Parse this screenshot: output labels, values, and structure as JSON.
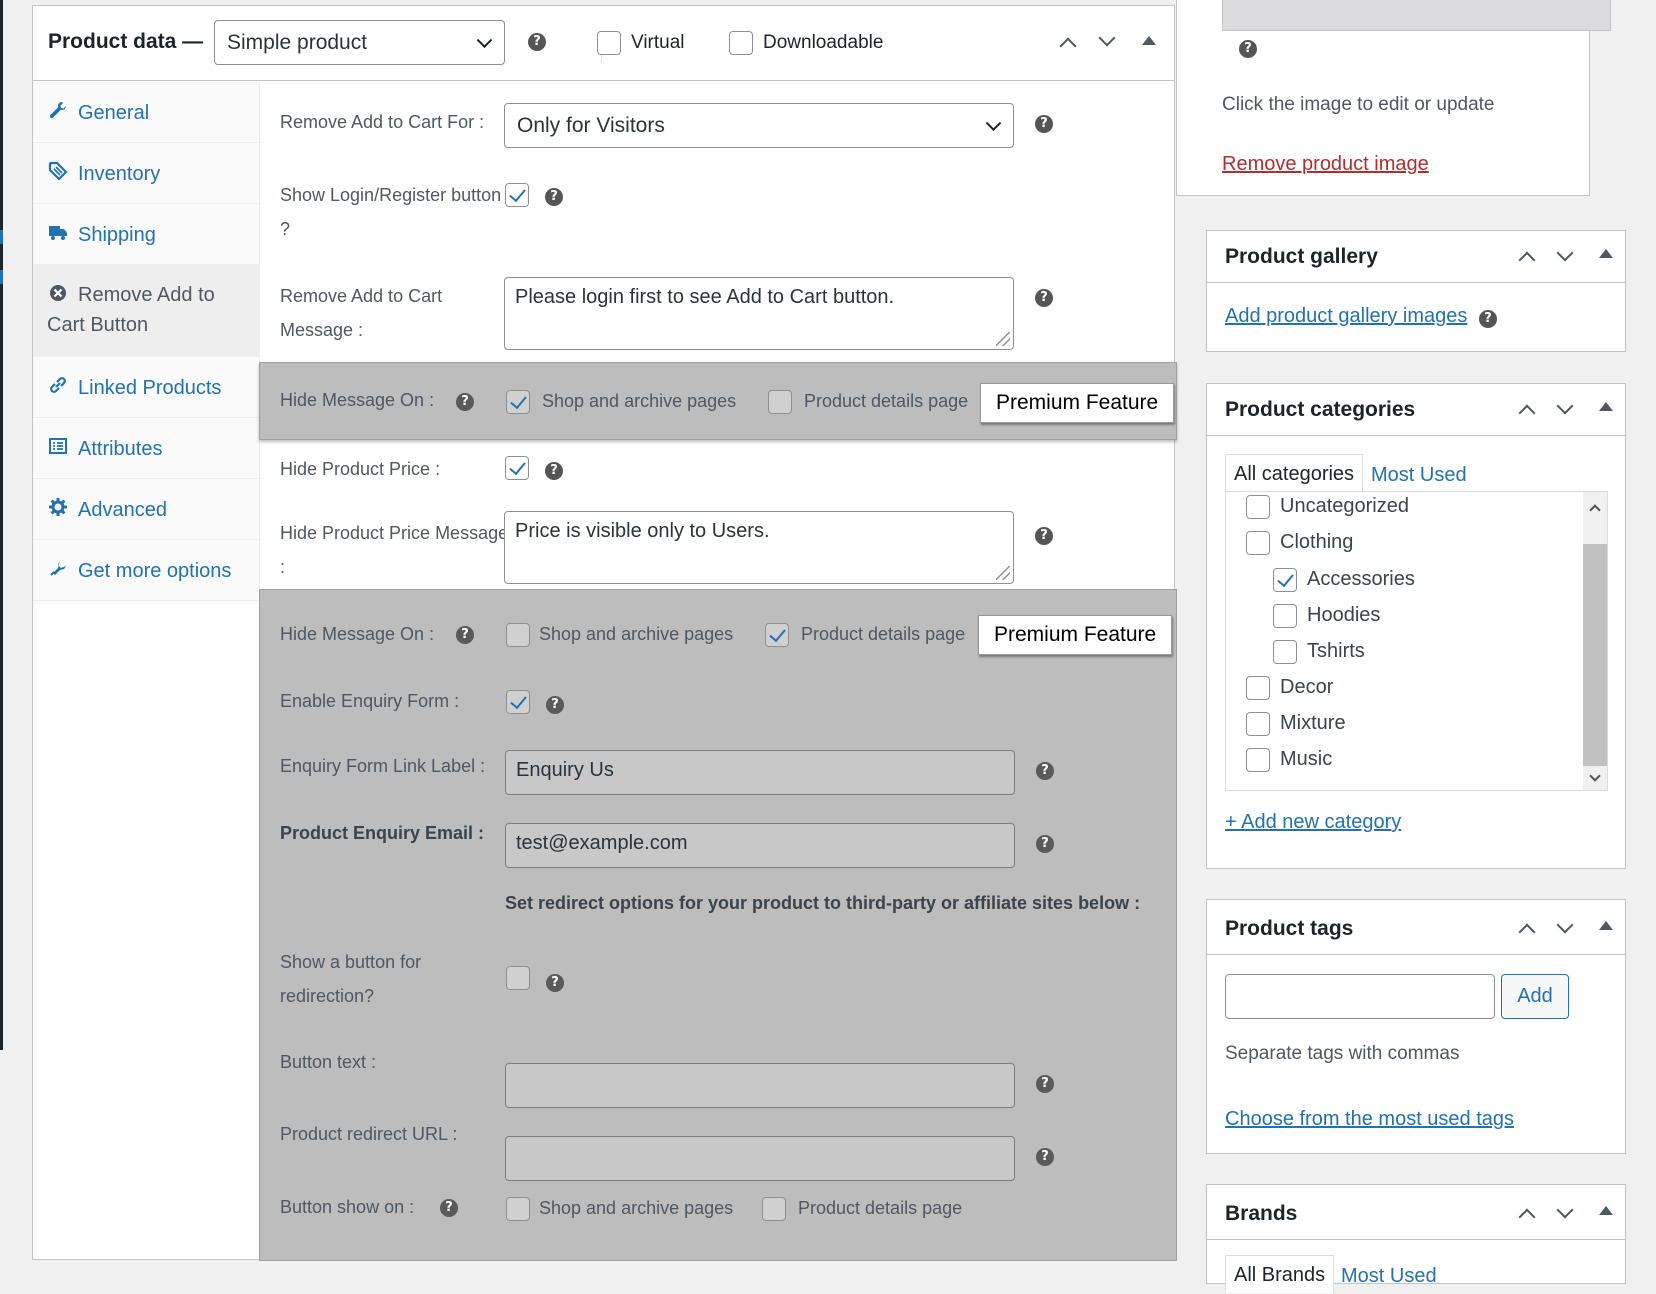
{
  "product_data": {
    "title": "Product data —",
    "product_type": "Simple product",
    "virtual_label": "Virtual",
    "downloadable_label": "Downloadable"
  },
  "tabs": [
    {
      "label": "General",
      "icon": "wrench-icon"
    },
    {
      "label": "Inventory",
      "icon": "tag-icon"
    },
    {
      "label": "Shipping",
      "icon": "truck-icon"
    },
    {
      "label": "Remove Add to Cart Button",
      "icon": "close-circle-icon"
    },
    {
      "label": "Linked Products",
      "icon": "link-icon"
    },
    {
      "label": "Attributes",
      "icon": "list-icon"
    },
    {
      "label": "Advanced",
      "icon": "gear-icon"
    },
    {
      "label": "Get more options",
      "icon": "plugin-icon"
    }
  ],
  "panel": {
    "remove_for_label": "Remove Add to Cart For :",
    "remove_for_value": "Only for Visitors",
    "show_login_label": "Show Login/Register button ?",
    "remove_message_label": "Remove Add to Cart Message :",
    "remove_message_value": "Please login first to see Add to Cart button.",
    "hide_message_on_label": "Hide Message On :",
    "shop_archive_label": "Shop and archive pages",
    "product_details_label": "Product details page",
    "premium_label": "Premium Feature",
    "hide_price_label": "Hide Product Price :",
    "hide_price_message_label": "Hide Product Price Message :",
    "hide_price_message_value": "Price is visible only to Users.",
    "enable_enquiry_label": "Enable Enquiry Form :",
    "enquiry_link_label": "Enquiry Form Link Label :",
    "enquiry_link_value": "Enquiry Us",
    "enquiry_email_label": "Product Enquiry Email :",
    "enquiry_email_value": "test@example.com",
    "redirect_heading": "Set redirect options for your product to third-party or affiliate sites below :",
    "show_redirect_label": "Show a button for redirection?",
    "button_text_label": "Button text :",
    "redirect_url_label": "Product redirect URL :",
    "button_show_on_label": "Button show on :"
  },
  "sidebar": {
    "image_hint": "Click the image to edit or update",
    "remove_image": "Remove product image",
    "gallery_title": "Product gallery",
    "gallery_link": "Add product gallery images",
    "categories_title": "Product categories",
    "cat_tab_all": "All categories",
    "cat_tab_most": "Most Used",
    "categories": [
      {
        "name": "Uncategorized",
        "checked": false,
        "child": false
      },
      {
        "name": "Clothing",
        "checked": false,
        "child": false
      },
      {
        "name": "Accessories",
        "checked": true,
        "child": true
      },
      {
        "name": "Hoodies",
        "checked": false,
        "child": true
      },
      {
        "name": "Tshirts",
        "checked": false,
        "child": true
      },
      {
        "name": "Decor",
        "checked": false,
        "child": false
      },
      {
        "name": "Mixture",
        "checked": false,
        "child": false
      },
      {
        "name": "Music",
        "checked": false,
        "child": false
      }
    ],
    "add_category": "+ Add new category",
    "tags_title": "Product tags",
    "tags_add": "Add",
    "tags_hint": "Separate tags with commas",
    "tags_choose": "Choose from the most used tags",
    "brands_title": "Brands",
    "brand_tab_all": "All Brands",
    "brand_tab_most": "Most Used"
  },
  "colors": {
    "accent": "#2271b1",
    "danger": "#b32d2e",
    "premium_bg": "#bdbdbd"
  }
}
